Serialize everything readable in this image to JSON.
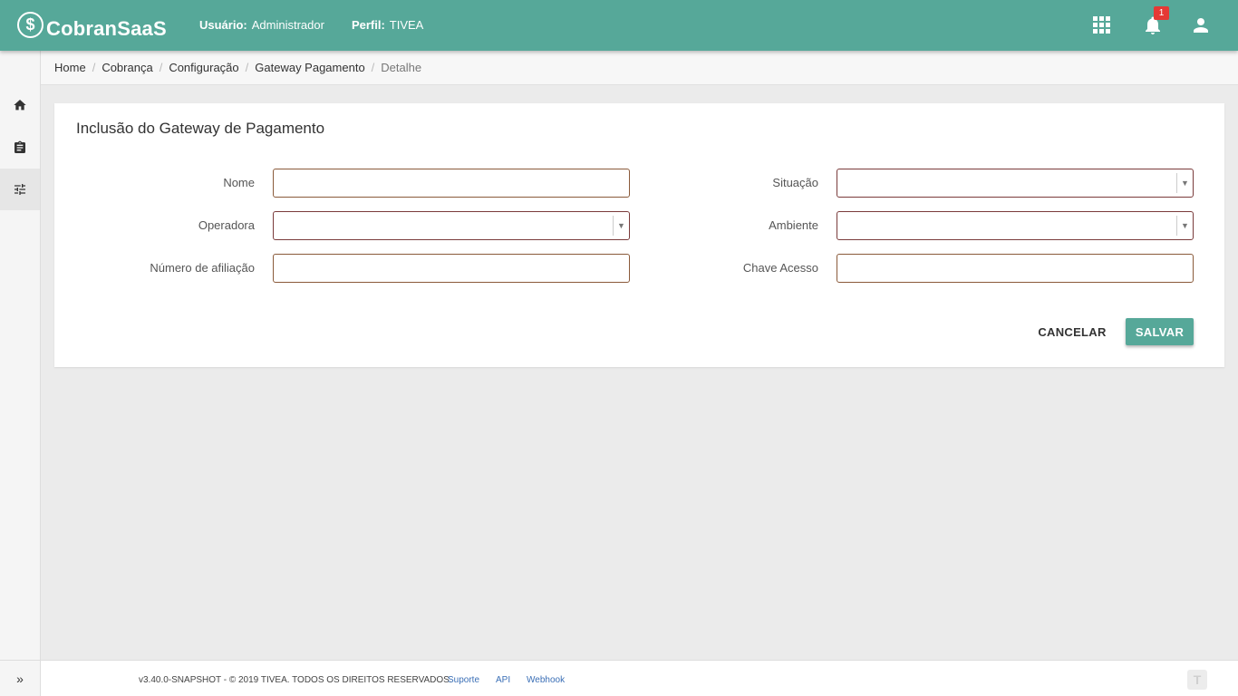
{
  "header": {
    "logo_text": "CobranSaaS",
    "logo_symbol": "$",
    "user_label": "Usuário:",
    "user_value": "Administrador",
    "profile_label": "Perfil:",
    "profile_value": "TIVEA",
    "notification_count": "1",
    "icons": [
      "apps-icon",
      "bell-icon",
      "user-icon"
    ],
    "color": "#56a899"
  },
  "sidebar": {
    "items": [
      {
        "name": "home",
        "icon": "home-icon"
      },
      {
        "name": "cobranca",
        "icon": "clipboard-icon"
      },
      {
        "name": "configuracao",
        "icon": "sliders-icon",
        "active": true
      }
    ],
    "expand_label": "»"
  },
  "breadcrumb": {
    "items": [
      "Home",
      "Cobrança",
      "Configuração",
      "Gateway Pagamento"
    ],
    "current": "Detalhe"
  },
  "form": {
    "title": "Inclusão do Gateway de Pagamento",
    "fields": {
      "nome": {
        "label": "Nome",
        "value": ""
      },
      "operadora": {
        "label": "Operadora",
        "value": ""
      },
      "numero_afiliacao": {
        "label": "Número de afiliação",
        "value": ""
      },
      "situacao": {
        "label": "Situação",
        "value": ""
      },
      "ambiente": {
        "label": "Ambiente",
        "value": ""
      },
      "chave_acesso": {
        "label": "Chave Acesso",
        "value": ""
      }
    },
    "cancel_label": "CANCELAR",
    "save_label": "SALVAR"
  },
  "footer": {
    "copyright": "v3.40.0-SNAPSHOT - © 2019 TIVEA. TODOS OS DIREITOS RESERVADOS.",
    "links": [
      "Suporte",
      "API",
      "Webhook"
    ],
    "logo_char": "T"
  }
}
